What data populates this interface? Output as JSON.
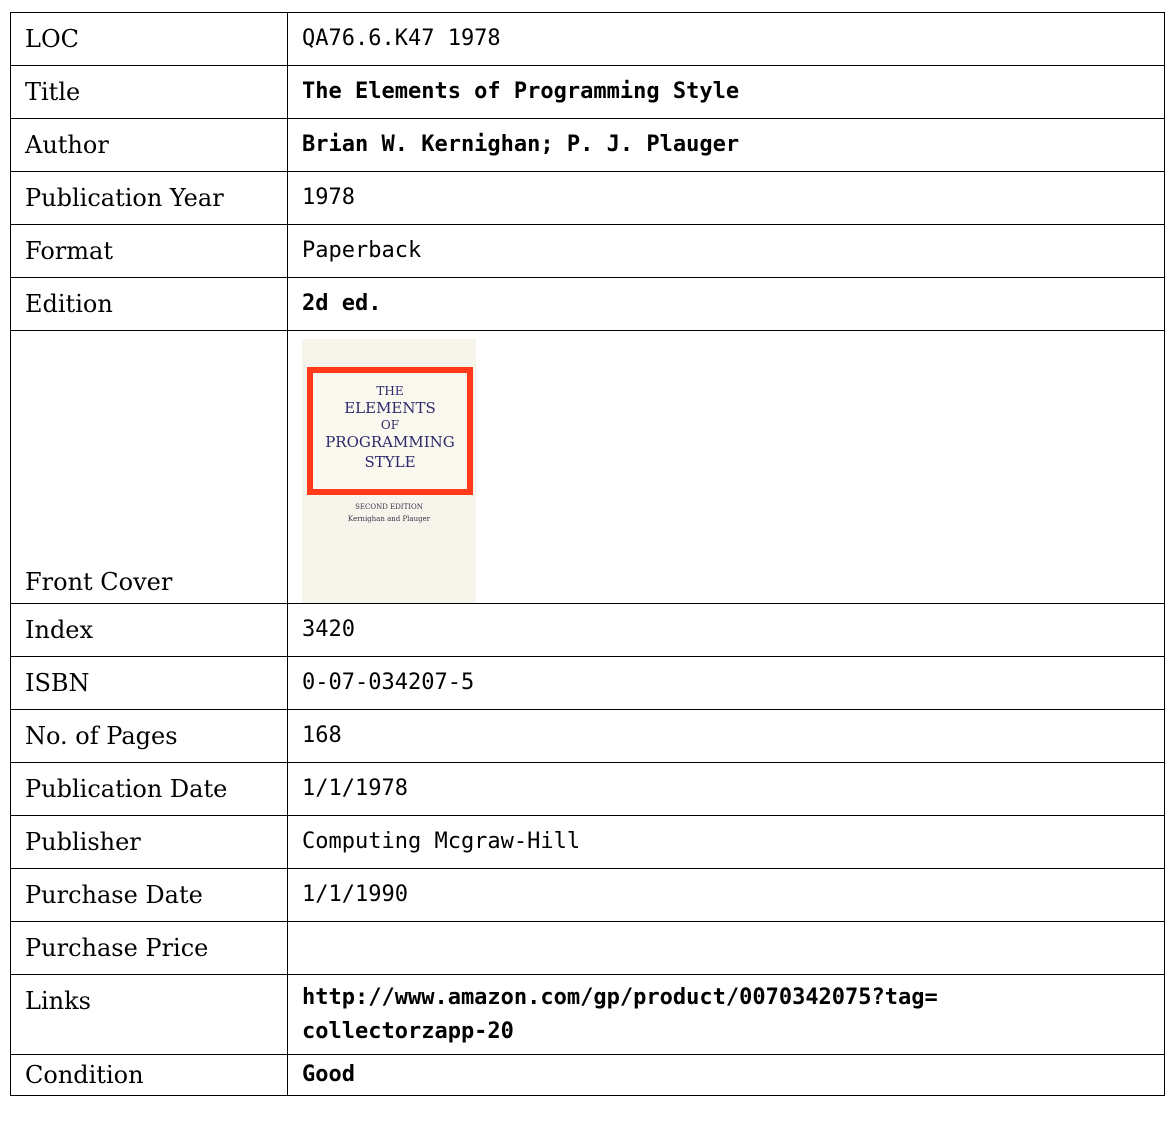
{
  "rows": {
    "loc": {
      "label": "LOC",
      "value": "QA76.6.K47 1978"
    },
    "title": {
      "label": "Title",
      "value": "The Elements of Programming Style"
    },
    "author": {
      "label": "Author",
      "value": "Brian W. Kernighan; P. J. Plauger"
    },
    "pub_year": {
      "label": "Publication Year",
      "value": "1978"
    },
    "format": {
      "label": "Format",
      "value": "Paperback"
    },
    "edition": {
      "label": "Edition",
      "value": "2d ed."
    },
    "front_cover": {
      "label": "Front Cover"
    },
    "index": {
      "label": "Index",
      "value": "3420"
    },
    "isbn": {
      "label": "ISBN",
      "value": "0-07-034207-5"
    },
    "pages": {
      "label": "No. of Pages",
      "value": "168"
    },
    "pub_date": {
      "label": "Publication Date",
      "value": "1/1/1978"
    },
    "publisher": {
      "label": "Publisher",
      "value": "Computing Mcgraw-Hill"
    },
    "purchase_date": {
      "label": "Purchase Date",
      "value": "1/1/1990"
    },
    "purchase_price": {
      "label": "Purchase Price",
      "value": ""
    },
    "links": {
      "label": "Links",
      "value_line1": "http://www.amazon.com/gp/product/0070342075?tag=",
      "value_line2": "collectorzapp-20"
    },
    "condition": {
      "label": "Condition",
      "value": "Good"
    }
  },
  "cover": {
    "line1": "THE",
    "line2": "ELEMENTS",
    "line3": "OF",
    "line4": "PROGRAMMING",
    "line5": "STYLE",
    "edition": "SECOND EDITION",
    "authors": "Kernighan and Plauger",
    "frame_color": "#ff3a1a",
    "text_color": "#2a2a6a"
  }
}
